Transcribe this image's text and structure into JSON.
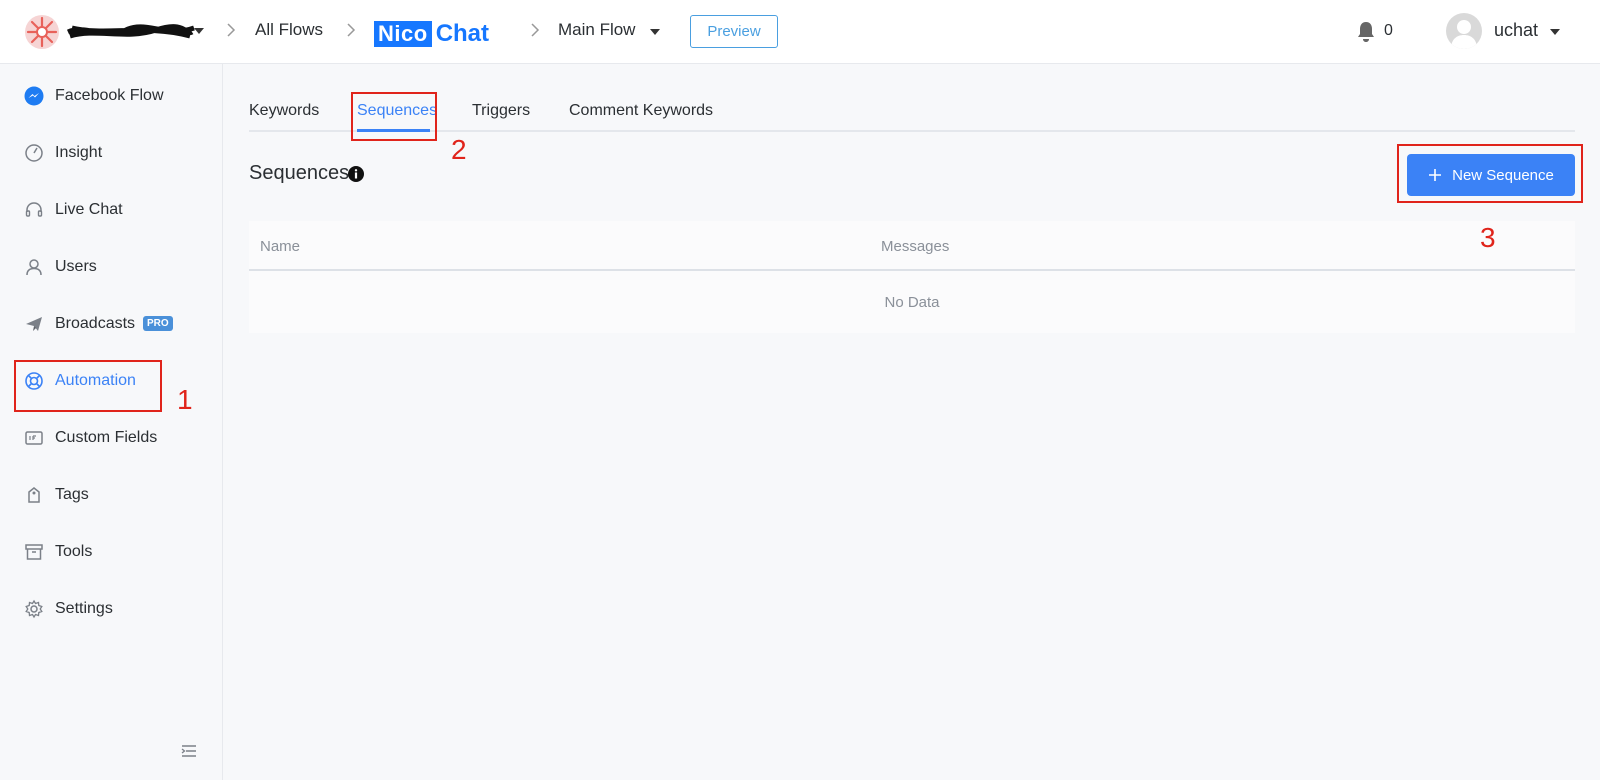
{
  "header": {
    "breadcrumbs": [
      "All Flows",
      "Main Flow"
    ],
    "brand_left": "Nico",
    "brand_right": "Chat",
    "preview_label": "Preview",
    "notification_count": "0",
    "username": "uchat"
  },
  "sidebar": {
    "items": [
      {
        "label": "Facebook Flow",
        "icon": "messenger-icon"
      },
      {
        "label": "Insight",
        "icon": "gauge-icon"
      },
      {
        "label": "Live Chat",
        "icon": "headset-icon"
      },
      {
        "label": "Users",
        "icon": "user-icon"
      },
      {
        "label": "Broadcasts",
        "icon": "paper-plane-icon",
        "badge": "PRO"
      },
      {
        "label": "Automation",
        "icon": "lifebuoy-icon",
        "active": true
      },
      {
        "label": "Custom Fields",
        "icon": "fields-icon"
      },
      {
        "label": "Tags",
        "icon": "tag-icon"
      },
      {
        "label": "Tools",
        "icon": "archive-icon"
      },
      {
        "label": "Settings",
        "icon": "gear-icon"
      }
    ]
  },
  "tabs": [
    {
      "label": "Keywords"
    },
    {
      "label": "Sequences",
      "active": true
    },
    {
      "label": "Triggers"
    },
    {
      "label": "Comment Keywords"
    }
  ],
  "main": {
    "section_title": "Sequences",
    "new_button_label": "New Sequence",
    "table": {
      "columns": [
        "Name",
        "Messages"
      ],
      "empty_text": "No Data"
    }
  },
  "annotations": [
    "1",
    "2",
    "3"
  ],
  "colors": {
    "accent": "#3b82f6",
    "brand": "#1677ff",
    "annotation": "#e0241b"
  }
}
